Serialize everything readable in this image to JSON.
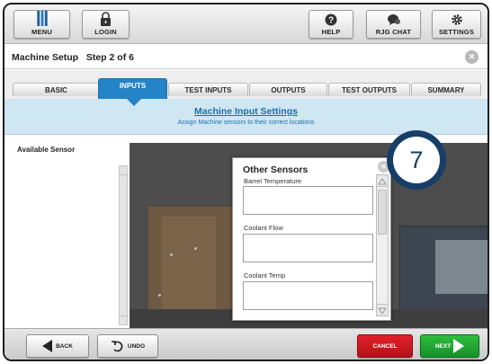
{
  "toolbar": {
    "menu_label": "MENU",
    "login_label": "LOGIN",
    "help_label": "HELP",
    "chat_label": "RJG CHAT",
    "settings_label": "SETTINGS"
  },
  "header": {
    "title": "Machine Setup   Step 2 of 6",
    "close_icon": "close-icon"
  },
  "tabs": [
    {
      "label": "BASIC",
      "active": false
    },
    {
      "label": "INPUTS",
      "active": true
    },
    {
      "label": "TEST INPUTS",
      "active": false
    },
    {
      "label": "OUTPUTS",
      "active": false
    },
    {
      "label": "TEST OUTPUTS",
      "active": false
    },
    {
      "label": "SUMMARY",
      "active": false
    }
  ],
  "banner": {
    "title": "Machine Input Settings",
    "subtitle": "Assign Machine sensors to their correct locations"
  },
  "sensors_panel": {
    "label": "Available Sensor"
  },
  "modal": {
    "title": "Other Sensors",
    "slots": [
      {
        "label": "Barrel Temperature",
        "value": ""
      },
      {
        "label": "Coolant Flow",
        "value": ""
      },
      {
        "label": "Coolant Temp",
        "value": ""
      }
    ]
  },
  "step_badge": {
    "number": "7"
  },
  "footer": {
    "back_label": "BACK",
    "undo_label": "UNDO",
    "cancel_label": "CANCEL",
    "next_label": "NEXT"
  },
  "colors": {
    "accent": "#2583c7",
    "banner_bg": "#cfe6f3",
    "badge": "#163e67",
    "cancel": "#d41a22",
    "next": "#22a834"
  }
}
